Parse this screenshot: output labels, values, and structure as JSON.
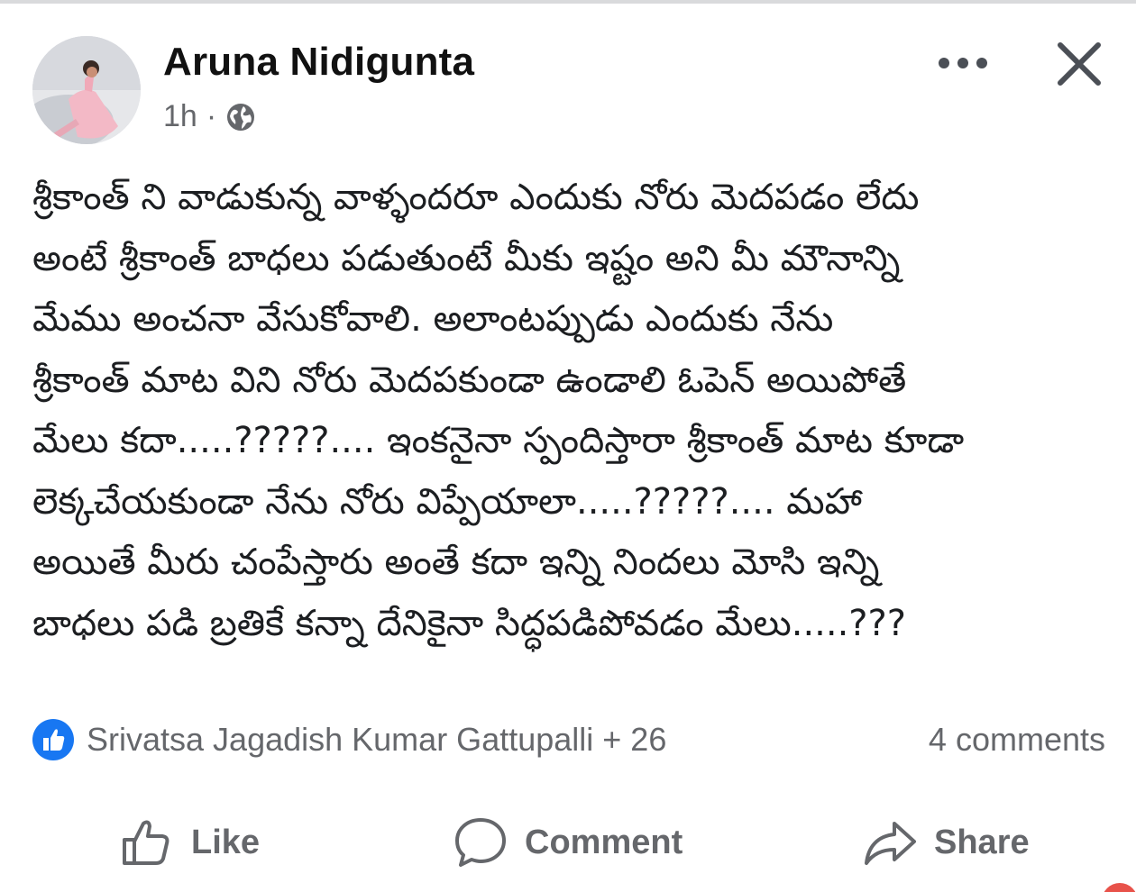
{
  "post": {
    "author": "Aruna Nidigunta",
    "time": "1h",
    "separator": "·",
    "privacy_icon": "globe-icon",
    "text": "శ్రీకాంత్ ని వాడుకున్న వాళ్ళందరూ ఎందుకు నోరు మెదపడం లేదు\nఅంటే శ్రీకాంత్ బాధలు పడుతుంటే మీకు ఇష్టం అని మీ మౌనాన్ని\nమేము అంచనా వేసుకోవాలి. అలాంటప్పుడు ఎందుకు నేను\nశ్రీకాంత్ మాట విని నోరు మెదపకుండా ఉండాలి ఓపెన్ అయిపోతే\nమేలు కదా.....?????.... ఇంకనైనా స్పందిస్తారా శ్రీకాంత్ మాట కూడా\nలెక్కచేయకుండా నేను నోరు విప్పేయాలా.....?????.... మహా\nఅయితే మీరు చంపేస్తారు అంతే కదా ఇన్ని నిందలు మోసి ఇన్ని\nబాధలు పడి బ్రతికే కన్నా దేనికైనా సిద్ధపడిపోవడం మేలు.....???"
  },
  "reactions": {
    "icon": "like-icon",
    "summary": "Srivatsa Jagadish Kumar Gattupalli + 26",
    "comments": "4 comments"
  },
  "actions": {
    "like": "Like",
    "comment": "Comment",
    "share": "Share"
  },
  "colors": {
    "text": "#1c1e21",
    "muted": "#65676b",
    "like_blue": "#1877f2"
  }
}
